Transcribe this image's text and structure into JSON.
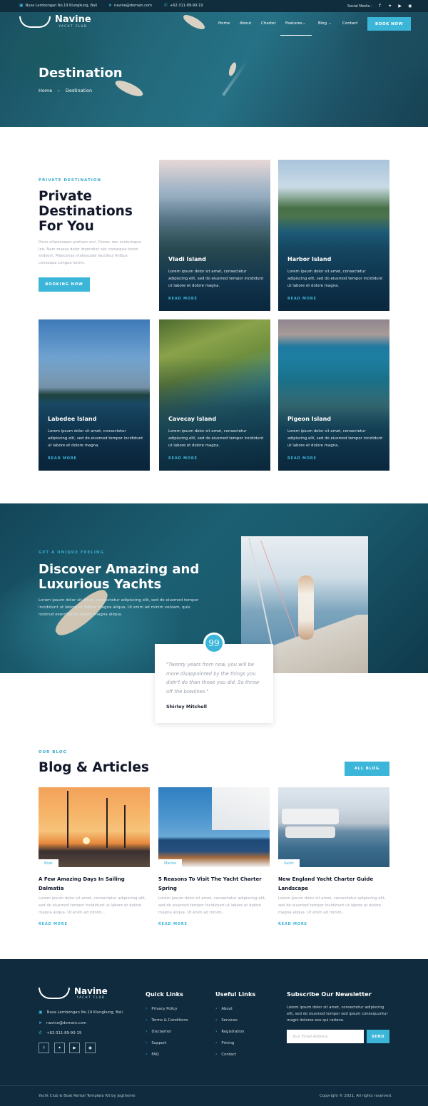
{
  "topbar": {
    "address": "Nusa Lembongan No.19 Klungkung, Bali",
    "email": "navine@domain.com",
    "phone": "+62-311-89-90-19",
    "social_label": "Social Media :"
  },
  "brand": {
    "name": "Navine",
    "sub": "YACHT CLUB"
  },
  "nav": {
    "items": [
      "Home",
      "About",
      "Charter",
      "Features",
      "Blog",
      "Contact"
    ],
    "book_label": "BOOK NOW"
  },
  "hero": {
    "title": "Destination",
    "crumb_home": "Home",
    "crumb_current": "Destination"
  },
  "private": {
    "label": "PRIVATE DESTINATION",
    "title": "Private Destinations For You",
    "text": "Proin ullamcorper pretium orci. Donec nec scelerisque leo. Nam massa dolor imperdiet nec consequa tacon sedsem. Maecenas malesuada faucibus finibus consequa congue lorem.",
    "button": "BOOKING NOW"
  },
  "destinations": [
    {
      "name": "Vladi Island",
      "desc": "Lorem ipsum dolor sit amet, consectetur adipiscing elit, sed do eiusmod tempor incididunt ut labore et dolore magna.",
      "more": "READ MORE"
    },
    {
      "name": "Harbor Island",
      "desc": "Lorem ipsum dolor sit amet, consectetur adipiscing elit, sed do eiusmod tempor incididunt ut labore et dolore magna.",
      "more": "READ MORE"
    },
    {
      "name": "Labedee Island",
      "desc": "Lorem ipsum dolor sit amet, consectetur adipiscing elit, sed do eiusmod tempor incididunt ut labore et dolore magna.",
      "more": "READ MORE"
    },
    {
      "name": "Cavecay Island",
      "desc": "Lorem ipsum dolor sit amet, consectetur adipiscing elit, sed do eiusmod tempor incididunt ut labore et dolore magna.",
      "more": "READ MORE"
    },
    {
      "name": "Pigeon Island",
      "desc": "Lorem ipsum dolor sit amet, consectetur adipiscing elit, sed do eiusmod tempor incididunt ut labore et dolore magna.",
      "more": "READ MORE"
    }
  ],
  "discover": {
    "label": "GET A UNIQUE FEELING",
    "title": "Discover Amazing and Luxurious Yachts",
    "text": "Lorem ipsum dolor sit amet, consectetur adipiscing elit, sed do eiusmod tempor incididunt ut labore et dolore magna aliqua. Ut enim ad minim veniam, quis nostrud exercitation dolore magna aliqua.",
    "quote_mark": "99",
    "quote": "\"Twenty years from now, you will be more disappointed by the things you didn't do than those you did. So throw off the bowlines.\"",
    "author": "Shirley Mitchell"
  },
  "blog": {
    "label": "OUR BLOG",
    "title": "Blog & Articles",
    "all_label": "ALL BLOG",
    "posts": [
      {
        "tag": "Boat",
        "title": "A Few Amazing Days In Sailing Dalmatia",
        "excerpt": "Lorem ipsum dolor sit amet, consectetur adipiscing elit, sed do eiusmod tempor incididunt ut labore et dolore magna aliqua. Ut enim ad minim...",
        "more": "READ MORE"
      },
      {
        "tag": "Marine",
        "title": "5 Reasons To Visit The Yacht Charter Spring",
        "excerpt": "Lorem ipsum dolor sit amet, consectetur adipiscing elit, sed do eiusmod tempor incididunt ut labore et dolore magna aliqua. Ut enim ad minim...",
        "more": "READ MORE"
      },
      {
        "tag": "Sailor",
        "title": "New England Yacht Charter Guide Landscape",
        "excerpt": "Lorem ipsum dolor sit amet, consectetur adipiscing elit, sed do eiusmod tempor incididunt ut labore et dolore magna aliqua. Ut enim ad minim...",
        "more": "READ MORE"
      }
    ]
  },
  "footer": {
    "address": "Nusa Lembongan No.19 Klungkung, Bali",
    "email": "navine@domain.com",
    "phone": "+62-311-89-90-19",
    "quick_title": "Quick Links",
    "quick_links": [
      "Privacy Policy",
      "Terms & Conditions",
      "Disclaimer",
      "Support",
      "FAQ"
    ],
    "useful_title": "Useful Links",
    "useful_links": [
      "About",
      "Services",
      "Registration",
      "Pricing",
      "Contact"
    ],
    "news_title": "Subscribe Our Newsletter",
    "news_text": "Lorem ipsum dolor sit amet, consectetur adipiscing elit, sed do eiusmod tempor sed ipsum consequuntur magni dolores eos qui ratione.",
    "email_placeholder": "Your Email Address",
    "send_label": "SEND",
    "credit": "Yacht Club & Boat Rental Template Kit by Jegtheme",
    "copyright": "Copyright © 2021. All rights reserved."
  },
  "colors": {
    "accent": "#3bb5d8",
    "dark": "#0f2b3d"
  }
}
